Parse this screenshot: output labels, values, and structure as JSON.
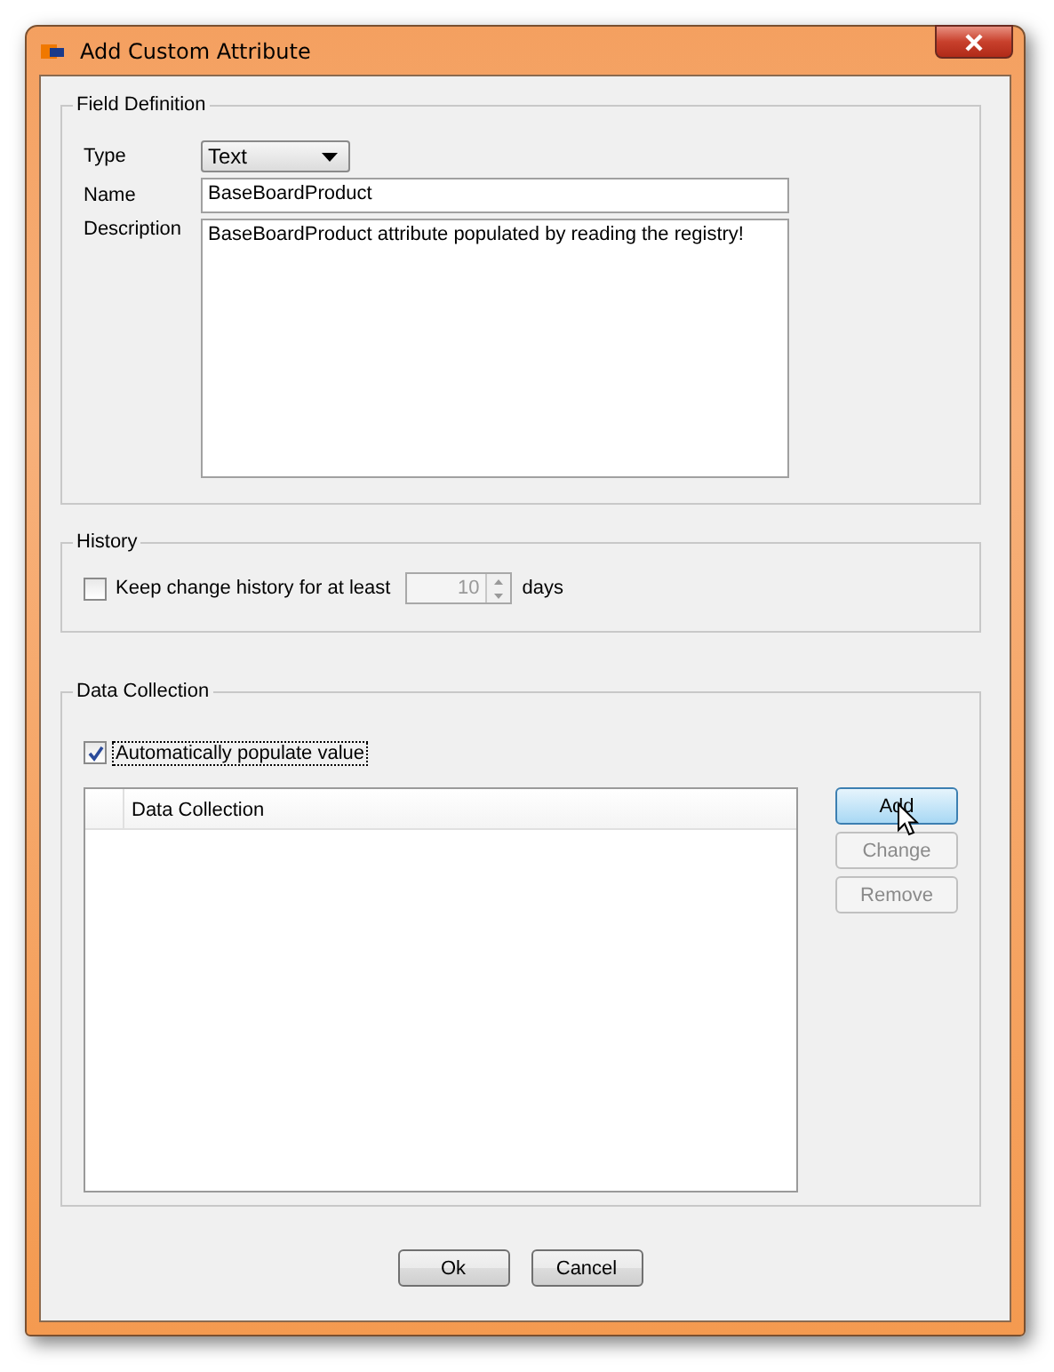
{
  "window": {
    "title": "Add Custom Attribute"
  },
  "field_definition": {
    "legend": "Field Definition",
    "type_label": "Type",
    "type_value": "Text",
    "name_label": "Name",
    "name_value": "BaseBoardProduct",
    "description_label": "Description",
    "description_value": "BaseBoardProduct attribute populated by reading the registry!"
  },
  "history": {
    "legend": "History",
    "checkbox": {
      "label": "Keep change history for at least",
      "checked": false
    },
    "days_value": "10",
    "days_disabled": true,
    "unit": "days"
  },
  "data_collection": {
    "legend": "Data Collection",
    "checkbox": {
      "label": "Automatically populate value",
      "checked": true,
      "focused": true
    },
    "table": {
      "columns": [
        "Data Collection"
      ]
    },
    "buttons": [
      {
        "label": "Add",
        "disabled": false,
        "hovered": true
      },
      {
        "label": "Change",
        "disabled": true,
        "hovered": false
      },
      {
        "label": "Remove",
        "disabled": true,
        "hovered": false
      }
    ]
  },
  "buttons": [
    {
      "label": "Ok"
    },
    {
      "label": "Cancel"
    }
  ]
}
